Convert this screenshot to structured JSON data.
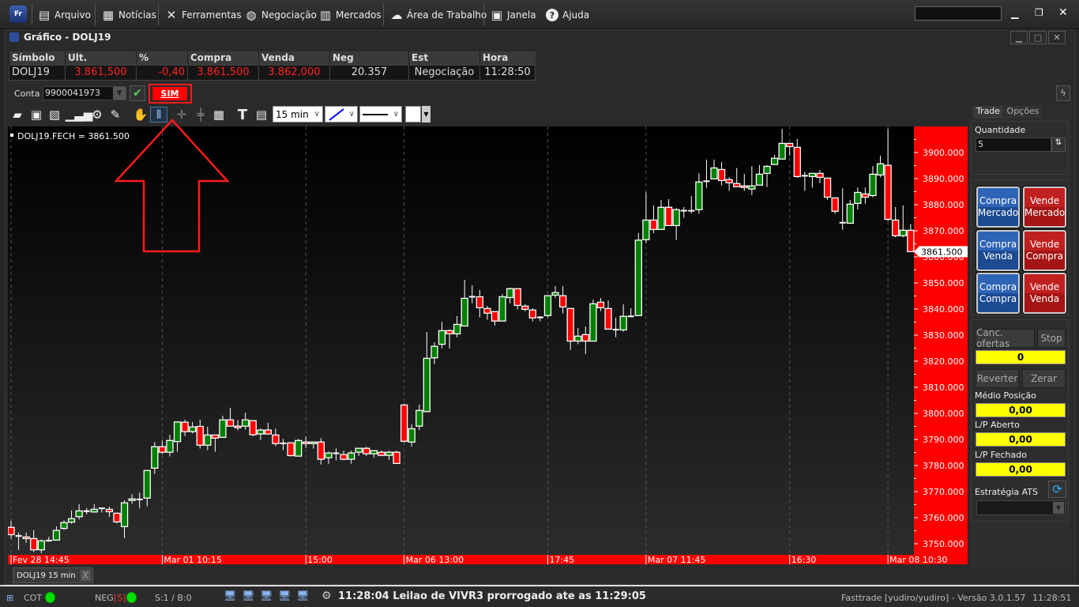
{
  "menu": {
    "logo": "Fr",
    "items": [
      {
        "label": "Arquivo",
        "icon": "file-icon"
      },
      {
        "label": "Notícias",
        "icon": "news-icon"
      },
      {
        "label": "Ferramentas",
        "icon": "tools-icon"
      },
      {
        "label": "Negociação",
        "icon": "trade-icon"
      },
      {
        "label": "Mercados",
        "icon": "building-icon"
      },
      {
        "label": "Área de Trabalho",
        "icon": "workspace-icon"
      },
      {
        "label": "Janela",
        "icon": "window-icon"
      },
      {
        "label": "Ajuda",
        "icon": "help-icon"
      }
    ],
    "search_value": ""
  },
  "window": {
    "title": "Gráfico - DOLJ19"
  },
  "quote": {
    "headers": [
      "Símbolo",
      "Ult.",
      "%",
      "Compra",
      "Venda",
      "Neg",
      "Est",
      "Hora"
    ],
    "values": [
      "DOLJ19",
      "3.861,500",
      "-0,40",
      "3.861,500",
      "3.862,000",
      "20.357",
      "Negociação",
      "11:28:50"
    ]
  },
  "account": {
    "label": "Conta",
    "value": "9900041973",
    "sim_label": "SIM"
  },
  "toolbar": {
    "interval": "15 min"
  },
  "chart_data": {
    "type": "candlestick",
    "legend": "DOLJ19.FECH = 3861.500",
    "last_price_label": "3861.500",
    "ylim": [
      3745,
      3910
    ],
    "yticks": [
      3750,
      3760,
      3770,
      3780,
      3790,
      3800,
      3810,
      3820,
      3830,
      3840,
      3850,
      3860,
      3870,
      3880,
      3890,
      3900
    ],
    "ytick_labels": [
      "3750.000",
      "3760.000",
      "3770.000",
      "3780.000",
      "3790.000",
      "3800.000",
      "3810.000",
      "3820.000",
      "3830.000",
      "3840.000",
      "3850.000",
      "3860.000",
      "3870.000",
      "3880.000",
      "3890.000",
      "3900.000"
    ],
    "xtick_labels": [
      {
        "i": 0,
        "label": "Fev 28 14:45"
      },
      {
        "i": 20,
        "label": "Mar 01 10:15"
      },
      {
        "i": 39,
        "label": "15:00"
      },
      {
        "i": 52,
        "label": "Mar 06 13:00"
      },
      {
        "i": 71,
        "label": "17:45"
      },
      {
        "i": 84,
        "label": "Mar 07 11:45"
      },
      {
        "i": 103,
        "label": "16:30"
      },
      {
        "i": 116,
        "label": "Mar 08 10:30"
      }
    ],
    "grid": "vertical dashed",
    "colors": {
      "up": "#008000",
      "down": "#ff0000",
      "axis": "#ff0000"
    },
    "ohlc": [
      [
        3756.3,
        3758.7,
        3752,
        3753.5
      ],
      [
        3753,
        3754.3,
        3747.7,
        3753
      ],
      [
        3752.6,
        3754.3,
        3750.4,
        3752
      ],
      [
        3752,
        3755.2,
        3746.8,
        3747.7
      ],
      [
        3747.7,
        3751.7,
        3746.4,
        3751.1
      ],
      [
        3751.2,
        3752.7,
        3750.8,
        3751.2
      ],
      [
        3751.4,
        3756.7,
        3751.4,
        3755.1
      ],
      [
        3755.9,
        3759,
        3755.3,
        3758.1
      ],
      [
        3758.3,
        3762.8,
        3757.7,
        3759.6
      ],
      [
        3760.4,
        3765.2,
        3759.3,
        3762.6
      ],
      [
        3762.5,
        3763.7,
        3761.3,
        3762.5
      ],
      [
        3762.2,
        3765.2,
        3762,
        3763.2
      ],
      [
        3763.6,
        3763.6,
        3762,
        3763.6
      ],
      [
        3763.2,
        3764.2,
        3760.3,
        3762.3
      ],
      [
        3761.7,
        3762,
        3757.8,
        3758.4
      ],
      [
        3756.6,
        3766.6,
        3752.2,
        3765.7
      ],
      [
        3766.6,
        3769,
        3765.3,
        3767.2
      ],
      [
        3767,
        3769.6,
        3763.6,
        3767
      ],
      [
        3767.5,
        3778.1,
        3764.4,
        3778.1
      ],
      [
        3779,
        3789,
        3776.8,
        3787.2
      ],
      [
        3787.2,
        3789.6,
        3784.4,
        3785.1
      ],
      [
        3785.1,
        3791.8,
        3783.5,
        3789.6
      ],
      [
        3789.2,
        3797,
        3785.3,
        3796.7
      ],
      [
        3796.6,
        3797.6,
        3791.3,
        3793
      ],
      [
        3793,
        3796.7,
        3792.3,
        3794.8
      ],
      [
        3795,
        3797.6,
        3786.5,
        3787.8
      ],
      [
        3787.8,
        3794.9,
        3785.9,
        3791.7
      ],
      [
        3791.7,
        3791.7,
        3785.3,
        3790.5
      ],
      [
        3790.8,
        3799.1,
        3790.8,
        3797.5
      ],
      [
        3797.5,
        3802.1,
        3795.1,
        3795.1
      ],
      [
        3795.1,
        3797.5,
        3793.5,
        3794.5
      ],
      [
        3795.1,
        3800.3,
        3793.8,
        3797.5
      ],
      [
        3797.2,
        3797.2,
        3791.3,
        3791.8
      ],
      [
        3792.1,
        3794.2,
        3789.8,
        3793.6
      ],
      [
        3793.6,
        3796.4,
        3792.1,
        3792.1
      ],
      [
        3791.7,
        3794.2,
        3787.4,
        3788.4
      ],
      [
        3788.5,
        3790.2,
        3785.9,
        3788.5
      ],
      [
        3788.7,
        3788.7,
        3783.5,
        3783.8
      ],
      [
        3783.6,
        3790.2,
        3783.6,
        3789.6
      ],
      [
        3789,
        3791.1,
        3786.8,
        3788.4
      ],
      [
        3788.4,
        3789,
        3786.5,
        3789
      ],
      [
        3789,
        3790.5,
        3780.4,
        3782.4
      ],
      [
        3783,
        3785.3,
        3780.7,
        3784.8
      ],
      [
        3784.7,
        3786.6,
        3782,
        3784.7
      ],
      [
        3784.2,
        3785.7,
        3782,
        3782.4
      ],
      [
        3782.4,
        3785.7,
        3780.7,
        3784.8
      ],
      [
        3785.1,
        3786.6,
        3783.7,
        3786.6
      ],
      [
        3786.6,
        3787.2,
        3783.6,
        3784.5
      ],
      [
        3784.5,
        3785.7,
        3783,
        3785.7
      ],
      [
        3785.1,
        3785.7,
        3783.6,
        3783.9
      ],
      [
        3783.9,
        3785.7,
        3782.2,
        3785.1
      ],
      [
        3785.1,
        3785.7,
        3780.8,
        3780.8
      ],
      [
        3803.2,
        3803.7,
        3788.8,
        3789.3
      ],
      [
        3789,
        3795.8,
        3787.3,
        3794.1
      ],
      [
        3795.1,
        3803.3,
        3793.6,
        3801.1
      ],
      [
        3800.7,
        3831.2,
        3800.4,
        3821.1
      ],
      [
        3821.3,
        3827.3,
        3818.9,
        3825.7
      ],
      [
        3826.5,
        3835.2,
        3824.9,
        3831.7
      ],
      [
        3831.7,
        3832.2,
        3824.9,
        3830.5
      ],
      [
        3830.5,
        3837.3,
        3829.2,
        3834.1
      ],
      [
        3833.5,
        3851.2,
        3833.5,
        3844.1
      ],
      [
        3844.7,
        3849.1,
        3842.2,
        3844.7
      ],
      [
        3844.7,
        3847.3,
        3836.8,
        3840.5
      ],
      [
        3840.2,
        3841.2,
        3835.9,
        3838.4
      ],
      [
        3839,
        3839,
        3833.7,
        3835.4
      ],
      [
        3835.4,
        3845.7,
        3835.4,
        3844.7
      ],
      [
        3844.4,
        3848.2,
        3842.2,
        3847.8
      ],
      [
        3847.8,
        3847.8,
        3839.8,
        3841.4
      ],
      [
        3841.1,
        3841.8,
        3839.1,
        3839.9
      ],
      [
        3839.6,
        3840.3,
        3835.3,
        3836.6
      ],
      [
        3836.8,
        3837.3,
        3835.3,
        3836.8
      ],
      [
        3837.5,
        3845.1,
        3836.8,
        3845.1
      ],
      [
        3845.3,
        3848.8,
        3844.3,
        3846.3
      ],
      [
        3845.1,
        3848.8,
        3838.3,
        3840.8
      ],
      [
        3840.2,
        3840.2,
        3824.3,
        3827.7
      ],
      [
        3827.7,
        3832.7,
        3826.5,
        3829.6
      ],
      [
        3830.2,
        3833.3,
        3822.8,
        3827.7
      ],
      [
        3827.7,
        3843.6,
        3827.7,
        3842
      ],
      [
        3842.6,
        3844.2,
        3839.2,
        3840.5
      ],
      [
        3840.2,
        3843.3,
        3832.3,
        3832.3
      ],
      [
        3832.1,
        3836.7,
        3829.2,
        3832.1
      ],
      [
        3832,
        3841.8,
        3831.3,
        3837.2
      ],
      [
        3837.2,
        3840.3,
        3836.8,
        3837.2
      ],
      [
        3837.5,
        3869.1,
        3837.5,
        3866.4
      ],
      [
        3866.6,
        3884.7,
        3865.3,
        3874.1
      ],
      [
        3874.1,
        3879.7,
        3869.1,
        3870.5
      ],
      [
        3870.5,
        3881.8,
        3870.5,
        3879
      ],
      [
        3879,
        3882.1,
        3872,
        3872
      ],
      [
        3872,
        3878.7,
        3866.5,
        3878.1
      ],
      [
        3877.7,
        3879.1,
        3875,
        3877.7
      ],
      [
        3877.7,
        3883.3,
        3876.7,
        3877.7
      ],
      [
        3878.1,
        3892.1,
        3876.5,
        3888.7
      ],
      [
        3889,
        3897.3,
        3886.5,
        3889
      ],
      [
        3889.9,
        3897.3,
        3889.9,
        3894.1
      ],
      [
        3893.5,
        3896.4,
        3887.4,
        3889.3
      ],
      [
        3889.6,
        3890.5,
        3885.3,
        3888.4
      ],
      [
        3888.1,
        3894.1,
        3886.9,
        3886.9
      ],
      [
        3887.2,
        3891.8,
        3885.3,
        3886.6
      ],
      [
        3886,
        3894.8,
        3883.7,
        3887.2
      ],
      [
        3887.5,
        3895.2,
        3887.5,
        3891.7
      ],
      [
        3892,
        3895.2,
        3886.8,
        3894.7
      ],
      [
        3895.4,
        3899.1,
        3895.4,
        3897.8
      ],
      [
        3897.5,
        3909.1,
        3897.5,
        3903.5
      ],
      [
        3903.5,
        3903.5,
        3898.9,
        3902.3
      ],
      [
        3902,
        3905.2,
        3890.3,
        3890.8
      ],
      [
        3891.1,
        3892.6,
        3885.3,
        3891.1
      ],
      [
        3890.8,
        3892,
        3886.5,
        3892
      ],
      [
        3892,
        3893.3,
        3888.3,
        3890.5
      ],
      [
        3890.2,
        3890.2,
        3881.9,
        3882.9
      ],
      [
        3882.6,
        3882.6,
        3876.5,
        3877.5
      ],
      [
        3873.1,
        3886.3,
        3870.4,
        3873.1
      ],
      [
        3872.9,
        3881.8,
        3872.9,
        3880.2
      ],
      [
        3880.5,
        3886.6,
        3878.2,
        3884.7
      ],
      [
        3884.1,
        3886.6,
        3880.4,
        3882.9
      ],
      [
        3883.5,
        3894.8,
        3882.9,
        3891.7
      ],
      [
        3891.4,
        3898.8,
        3890.5,
        3895.7
      ],
      [
        3895.1,
        3909.1,
        3873.8,
        3874.4
      ],
      [
        3874.1,
        3879.1,
        3867.5,
        3868.1
      ],
      [
        3868.1,
        3879.7,
        3867.5,
        3870.2
      ],
      [
        3870.2,
        3872.6,
        3862,
        3862
      ]
    ]
  },
  "panel": {
    "tabs": [
      "Trade",
      "Opções"
    ],
    "quantity_label": "Quantidade",
    "quantity": "5",
    "buttons": [
      [
        "Compra Mercado",
        "Vende Mercado"
      ],
      [
        "Compra Venda",
        "Vende Compra"
      ],
      [
        "Compra Compra",
        "Vende Venda"
      ]
    ],
    "cancel_label": "Canc. ofertas",
    "stop_label": "Stop",
    "position": "0",
    "reverse_label": "Reverter",
    "zero_label": "Zerar",
    "avg_label": "Médio Posição",
    "avg_value": "0,00",
    "open_label": "L/P Aberto",
    "open_value": "0,00",
    "closed_label": "L/P Fechado",
    "closed_value": "0,00",
    "ats_label": "Estratégia ATS",
    "ats_value": ""
  },
  "chart_tab": {
    "label": "DOLJ19 15 min",
    "close": "X"
  },
  "status": {
    "cot": "COT",
    "neg": "NEG",
    "neg_flag": "[S]",
    "sb": "S:1 / B:0",
    "message": "11:28:04 Leilao de VIVR3 prorrogado ate as 11:29:05",
    "version": "Fasttrade [yudiro/yudiro] - Versão 3.0.1.57",
    "clock": "11:28:51"
  }
}
